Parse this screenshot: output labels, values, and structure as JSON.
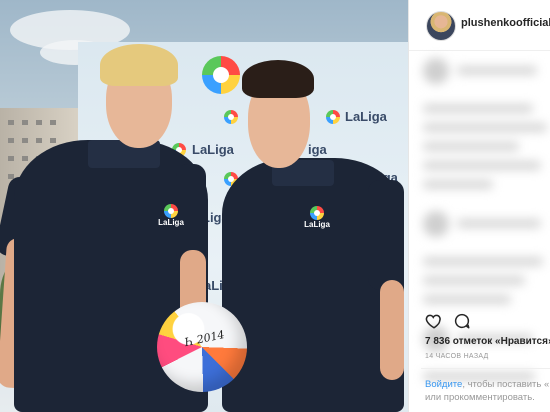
{
  "photo": {
    "backdrop_brand": "LaLiga",
    "shirt_badge_text": "LaLiga"
  },
  "post": {
    "username": "plushenkoofficial",
    "likes_text": "7 836 отметок «Нравится»",
    "timestamp": "14 часов назад",
    "login_link": "Войдите",
    "login_prompt_rest": ", чтобы поставить «Н",
    "login_prompt_line2": "или прокомментировать."
  },
  "icons": {
    "like": "heart-icon",
    "comment": "comment-icon"
  },
  "colors": {
    "link": "#3897f0",
    "muted": "#999999",
    "text": "#262626",
    "shirt": "#1c2536"
  }
}
